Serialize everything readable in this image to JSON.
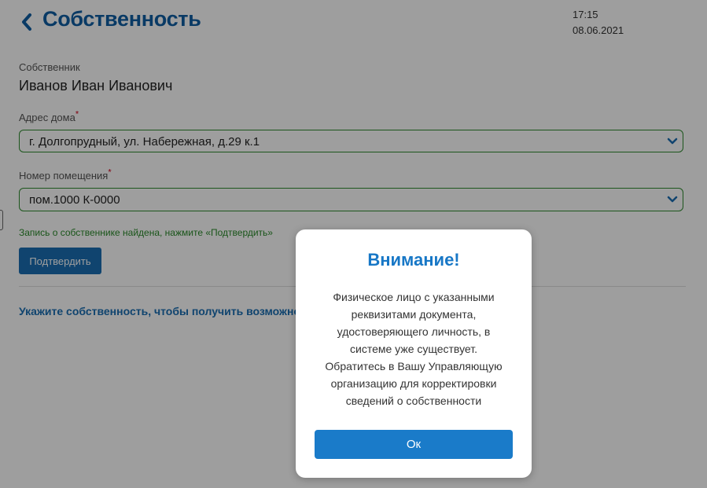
{
  "header": {
    "title": "Собственность",
    "time": "17:15",
    "date": "08.06.2021"
  },
  "form": {
    "owner_label": "Собственник",
    "owner_name": "Иванов Иван Иванович",
    "address_label": "Адрес дома",
    "address_value": "г. Долгопрудный, ул. Набережная, д.29 к.1",
    "premise_label": "Номер помещения",
    "premise_value": "пом.1000 К-0000",
    "required_mark": "*",
    "status_text": "Запись о собственнике найдена, нажмите «Подтвердить»",
    "confirm_label": "Подтвердить",
    "info_link": "Укажите собственность, чтобы получить возможность проголосовать"
  },
  "modal": {
    "title": "Внимание!",
    "message_lines": [
      "Физическое лицо с указанными",
      "реквизитами документа,",
      "удостоверяющего личность, в",
      "системе уже существует.",
      "Обратитесь в Вашу Управляющую",
      "организацию для корректировки",
      "сведений о собственности"
    ],
    "ok_label": "Ок"
  },
  "colors": {
    "title_blue": "#0f5ea3",
    "accent_blue": "#1a7bc9",
    "valid_green": "#2e8b2e",
    "required_red": "#d0021b"
  },
  "icons": {
    "back": "chevron-left-icon",
    "dropdown": "chevron-down-icon"
  }
}
